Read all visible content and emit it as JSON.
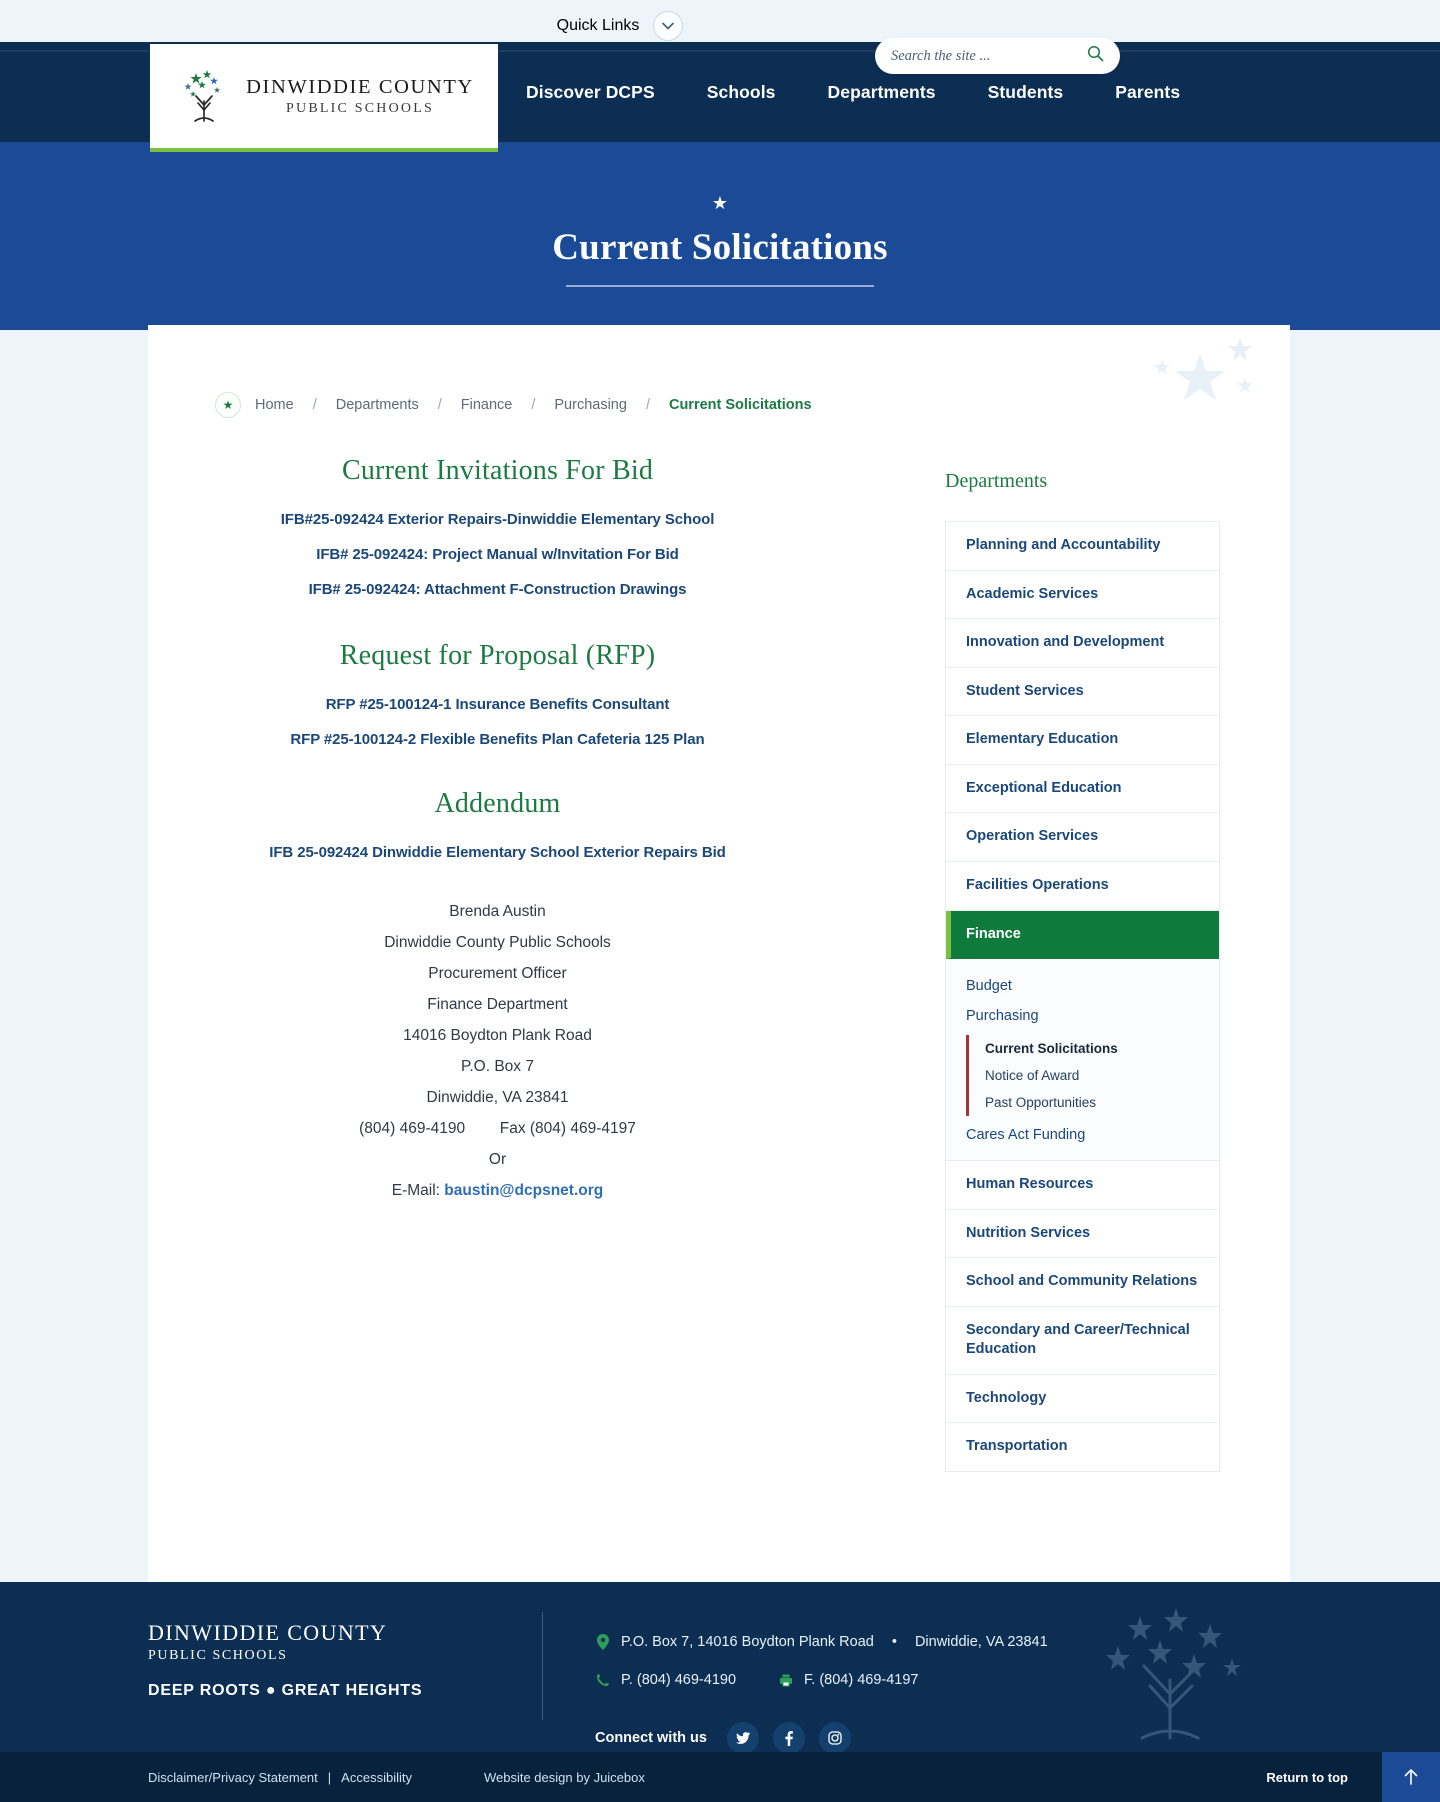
{
  "utility": {
    "quick_links_label": "Quick Links",
    "chevron_icon": "chevron-down-icon"
  },
  "header": {
    "logo": {
      "line1": "DINWIDDIE COUNTY",
      "line2": "PUBLIC SCHOOLS",
      "icon": "tree-with-stars-logo"
    },
    "nav": [
      {
        "label": "Discover DCPS"
      },
      {
        "label": "Schools"
      },
      {
        "label": "Departments"
      },
      {
        "label": "Students"
      },
      {
        "label": "Parents"
      }
    ],
    "search": {
      "placeholder": "Search the site ...",
      "value": "",
      "icon": "search-icon"
    }
  },
  "hero": {
    "star_icon": "star-icon",
    "title": "Current Solicitations"
  },
  "breadcrumb": {
    "badge_icon": "star-icon",
    "items": [
      {
        "label": "Home"
      },
      {
        "label": "Departments"
      },
      {
        "label": "Finance"
      },
      {
        "label": "Purchasing"
      }
    ],
    "separator": "/",
    "current": "Current Solicitations"
  },
  "main": {
    "sections": [
      {
        "title": "Current Invitations For Bid",
        "links": [
          "IFB#25-092424 Exterior Repairs-Dinwiddie Elementary School",
          "IFB# 25-092424: Project Manual w/Invitation For Bid",
          "IFB# 25-092424: Attachment F-Construction Drawings"
        ]
      },
      {
        "title": "Request for Proposal (RFP)",
        "links": [
          "RFP #25-100124-1  Insurance Benefits Consultant",
          "RFP #25-100124-2 Flexible Benefits Plan Cafeteria 125 Plan"
        ]
      },
      {
        "title": "Addendum",
        "links": [
          "IFB 25-092424 Dinwiddie Elementary School Exterior Repairs Bid"
        ]
      }
    ],
    "contact": {
      "name": "Brenda Austin",
      "org": "Dinwiddie County Public Schools",
      "role": "Procurement Officer",
      "dept": "Finance Department",
      "street": "14016 Boydton Plank Road",
      "po_box": "P.O. Box 7",
      "city_state_zip": "Dinwiddie, VA 23841",
      "phone": "(804) 469-4190",
      "fax": "Fax (804) 469-4197",
      "or_label": "Or",
      "email_label": "E-Mail:",
      "email": "baustin@dcpsnet.org"
    }
  },
  "sidebar": {
    "heading": "Departments",
    "items": [
      {
        "label": "Planning and Accountability"
      },
      {
        "label": "Academic Services"
      },
      {
        "label": "Innovation and Development"
      },
      {
        "label": "Student Services"
      },
      {
        "label": "Elementary Education"
      },
      {
        "label": "Exceptional Education"
      },
      {
        "label": "Operation Services"
      },
      {
        "label": "Facilities Operations"
      },
      {
        "label": "Finance"
      },
      {
        "label": "Human Resources"
      },
      {
        "label": "Nutrition Services"
      },
      {
        "label": "School and Community Relations"
      },
      {
        "label": "Secondary and Career/Technical Education"
      },
      {
        "label": "Technology"
      },
      {
        "label": "Transportation"
      }
    ],
    "active_label": "Finance",
    "sub_items": [
      {
        "label": "Budget"
      },
      {
        "label": "Purchasing"
      },
      {
        "label": "Cares Act Funding"
      }
    ],
    "third_level": [
      {
        "label": "Current Solicitations",
        "current": true
      },
      {
        "label": "Notice of Award",
        "current": false
      },
      {
        "label": "Past Opportunities",
        "current": false
      }
    ]
  },
  "footer": {
    "logo": {
      "line1": "DINWIDDIE COUNTY",
      "line2": "PUBLIC SCHOOLS"
    },
    "tagline": "DEEP ROOTS ● GREAT HEIGHTS",
    "address_icon": "location-pin-icon",
    "address": "P.O. Box 7, 14016 Boydton Plank Road",
    "address_sep": "•",
    "address_city": "Dinwiddie, VA 23841",
    "phone_icon": "phone-icon",
    "phone": "P. (804) 469-4190",
    "fax_icon": "fax-icon",
    "fax": "F. (804) 469-4197",
    "connect_label": "Connect with us",
    "social": [
      {
        "name": "twitter-icon"
      },
      {
        "name": "facebook-icon"
      },
      {
        "name": "instagram-icon"
      }
    ],
    "bottom": {
      "disclaimer": "Disclaimer/Privacy Statement",
      "divider": "|",
      "accessibility": "Accessibility",
      "credit": "Website design by Juicebox",
      "return_to_top": "Return to top",
      "top_icon": "arrow-up-icon"
    }
  },
  "colors": {
    "navy": "#0b2e52",
    "blue": "#1b4b96",
    "green": "#1d7a43",
    "active_green": "#0e7a3c",
    "accent_green": "#7ac143",
    "link_navy": "#1b4878",
    "red_rule": "#a5343a"
  }
}
